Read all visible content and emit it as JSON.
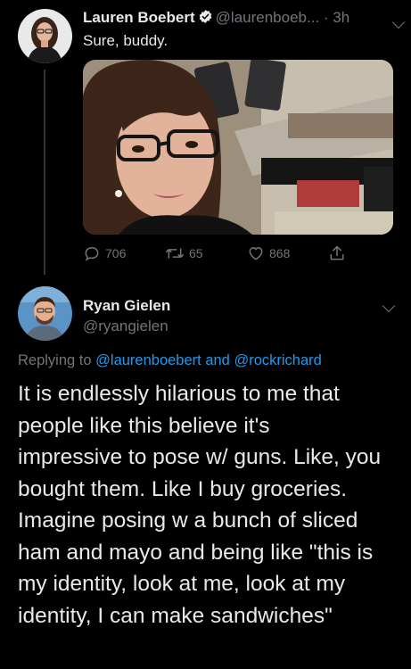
{
  "tweet1": {
    "author_name": "Lauren Boebert",
    "author_handle": "@laurenboeb...",
    "separator": " · ",
    "time": "3h",
    "text": "Sure, buddy.",
    "replies": "706",
    "retweets": "65",
    "likes": "868"
  },
  "tweet2": {
    "author_name": "Ryan Gielen",
    "author_handle": "@ryangielen",
    "replying_prefix": "Replying to",
    "replying_user1": "@laurenboebert",
    "replying_and": "and",
    "replying_user2": "@rockrichard",
    "text": "It is endlessly hilarious to me that\npeople like this believe it's\nimpressive to pose w/ guns. Like, you\nbought them. Like I buy groceries.\nImagine posing w a bunch of sliced\nham and mayo and being like \"this is\nmy identity, look at me, look at my\nidentity, I can make sandwiches\""
  },
  "colors": {
    "background": "#000000",
    "text": "#e7e9ea",
    "muted": "#71767b",
    "link": "#1d9bf0",
    "verified": "#1d9bf0"
  },
  "icons": [
    "verified-badge-icon",
    "chevron-down-icon",
    "reply-icon",
    "retweet-icon",
    "like-icon",
    "share-icon"
  ]
}
